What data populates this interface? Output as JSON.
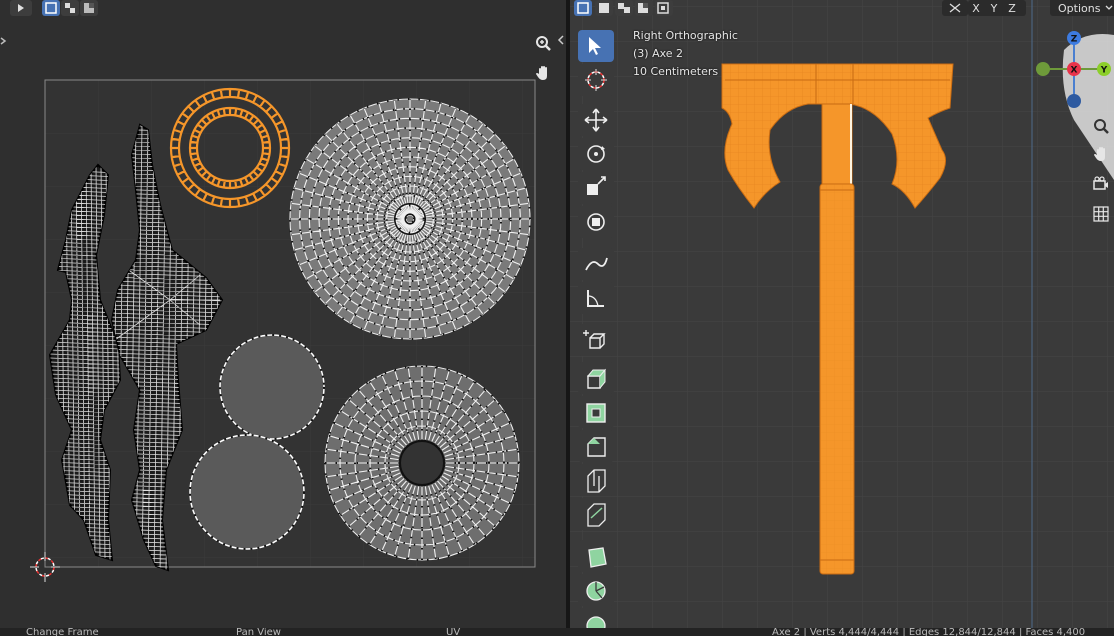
{
  "uv_editor": {
    "header_tools": [
      "select-mode-icon",
      "vertex-mode-icon",
      "edge-mode-icon"
    ]
  },
  "viewport": {
    "view_name": "Right Orthographic",
    "object_label": "(3) Axe 2",
    "scale_label": "10 Centimeters",
    "axis_buttons": [
      "X",
      "Y",
      "Z"
    ],
    "options_label": "Options",
    "gizmo": {
      "z_label": "Z",
      "x_label": "X",
      "y_label": "Y"
    }
  },
  "status_bar": {
    "left_action": "Change Frame",
    "middle_action": "Pan View",
    "right_action": "UV",
    "stats": "Axe 2 | Verts 4,444/4,444 | Edges 12,844/12,844 | Faces 4,400"
  },
  "colors": {
    "selection_orange": "#f5962a",
    "active_blue": "#4772b3",
    "uv_background": "#2f2f2f",
    "viewport_background": "#3a3a3a"
  }
}
